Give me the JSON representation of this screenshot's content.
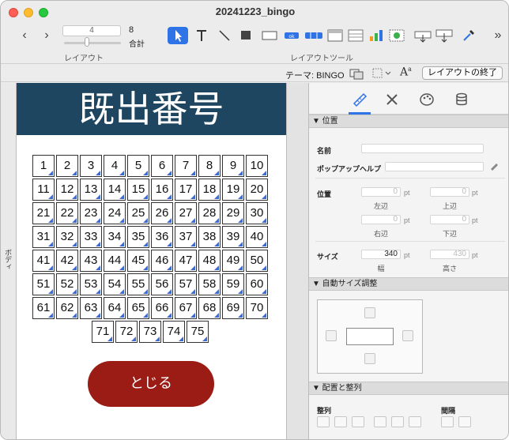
{
  "window": {
    "title": "20241223_bingo"
  },
  "toolbar": {
    "layout_field_value": "4",
    "layout_count": "8",
    "count_label": "合計",
    "layout_group_label": "レイアウト",
    "tools_group_label": "レイアウトツール",
    "tools": [
      "pointer-tool",
      "text-tool",
      "line-tool",
      "shape-tool",
      "field-tool",
      "button-tool",
      "button-bar-tool",
      "popover-button-tool",
      "portal-tool",
      "chart-tool",
      "web-viewer-tool",
      "insert-field-tool",
      "insert-part-tool",
      "format-painter-tool"
    ]
  },
  "theme_bar": {
    "theme_label": "テーマ: BINGO",
    "end_layout_button": "レイアウトの終了"
  },
  "canvas": {
    "body_part_label": "ボディ",
    "header_title": "既出番号",
    "numbers": [
      1,
      2,
      3,
      4,
      5,
      6,
      7,
      8,
      9,
      10,
      11,
      12,
      13,
      14,
      15,
      16,
      17,
      18,
      19,
      20,
      21,
      22,
      23,
      24,
      25,
      26,
      27,
      28,
      29,
      30,
      31,
      32,
      33,
      34,
      35,
      36,
      37,
      38,
      39,
      40,
      41,
      42,
      43,
      44,
      45,
      46,
      47,
      48,
      49,
      50,
      51,
      52,
      53,
      54,
      55,
      56,
      57,
      58,
      59,
      60,
      61,
      62,
      63,
      64,
      65,
      66,
      67,
      68,
      69,
      70,
      71,
      72,
      73,
      74,
      75
    ],
    "close_button": "とじる",
    "colors": {
      "header_bg": "#1f4661",
      "close_bg": "#9a1c14"
    }
  },
  "inspector": {
    "tabs": [
      "position-tab",
      "styles-tab",
      "appearance-tab",
      "data-tab"
    ],
    "position_section": "▼ 位置",
    "name_label": "名前",
    "popup_help_label": "ポップアップヘルプ",
    "position_label": "位置",
    "left_value": "0",
    "top_value": "0",
    "right_value": "0",
    "bottom_value": "0",
    "unit": "pt",
    "left_label": "左辺",
    "top_label": "上辺",
    "right_label": "右辺",
    "bottom_label": "下辺",
    "size_label": "サイズ",
    "width_value": "340",
    "height_value": "430",
    "width_label": "幅",
    "height_label": "高さ",
    "autosize_section": "▼ 自動サイズ調整",
    "arrange_section": "▼ 配置と整列",
    "align_label": "整列",
    "spacing_label": "間隔"
  }
}
